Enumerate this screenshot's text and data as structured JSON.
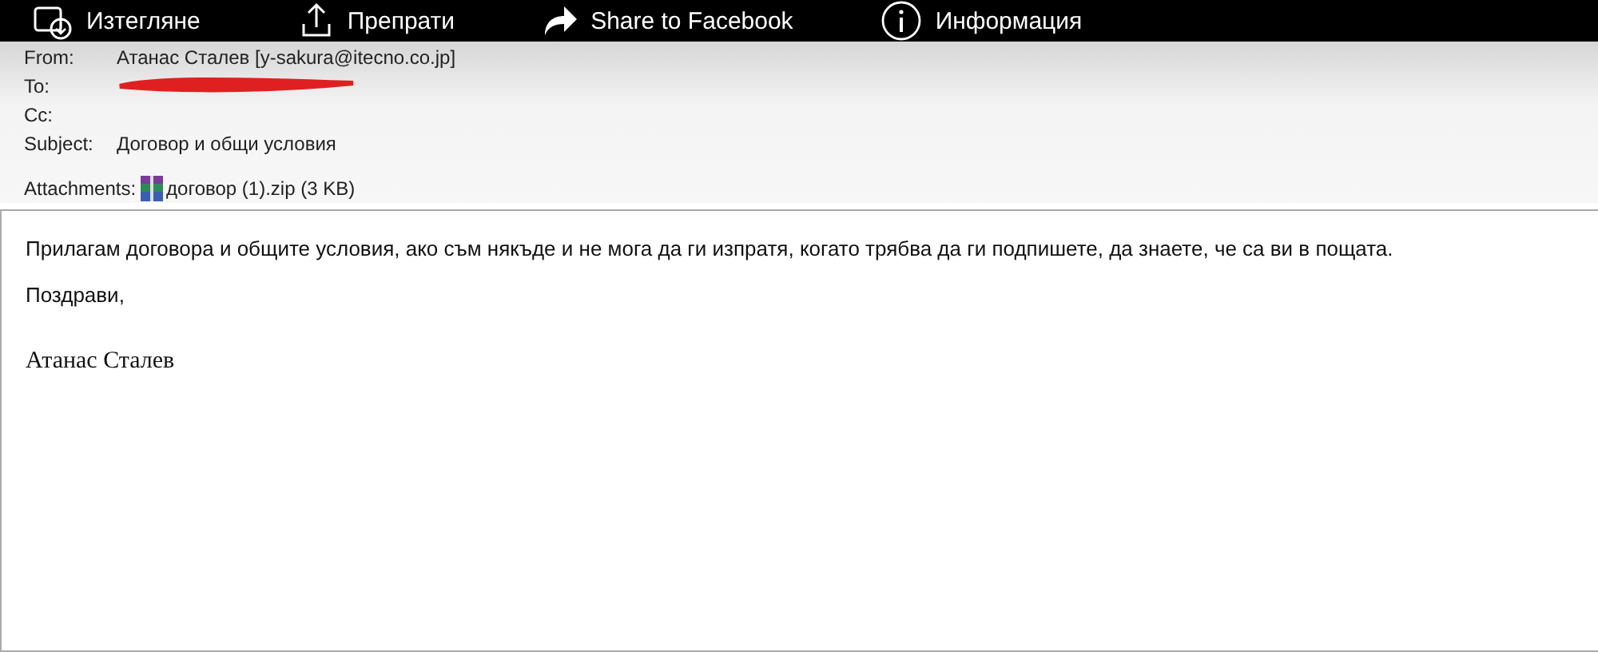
{
  "viewer_toolbar": [
    {
      "kind": "download",
      "label": "Изтегляне"
    },
    {
      "kind": "share",
      "label": "Препрати"
    },
    {
      "kind": "facebook",
      "label": "Share to Facebook"
    },
    {
      "kind": "info",
      "label": "Информация"
    }
  ],
  "header": {
    "fields": [
      {
        "label": "From:",
        "value": "Атанас Сталев [y-sakura@itecno.co.jp]"
      },
      {
        "label": "To:",
        "kind": "redacted"
      },
      {
        "label": "Cc:"
      },
      {
        "label": "Subject:",
        "value": "Договор и общи условия"
      }
    ],
    "attachments_label": "Attachments:",
    "attachment": "договор (1).zip (3 KB)"
  },
  "body": {
    "paragraphs": [
      "Прилагам договора и общите условия, ако съм някъде и не мога да ги изпратя, когато трябва да ги подпишете, да знаете, че са ви в пощата.",
      "Поздрави,"
    ],
    "signature": "Атанас Сталев"
  }
}
